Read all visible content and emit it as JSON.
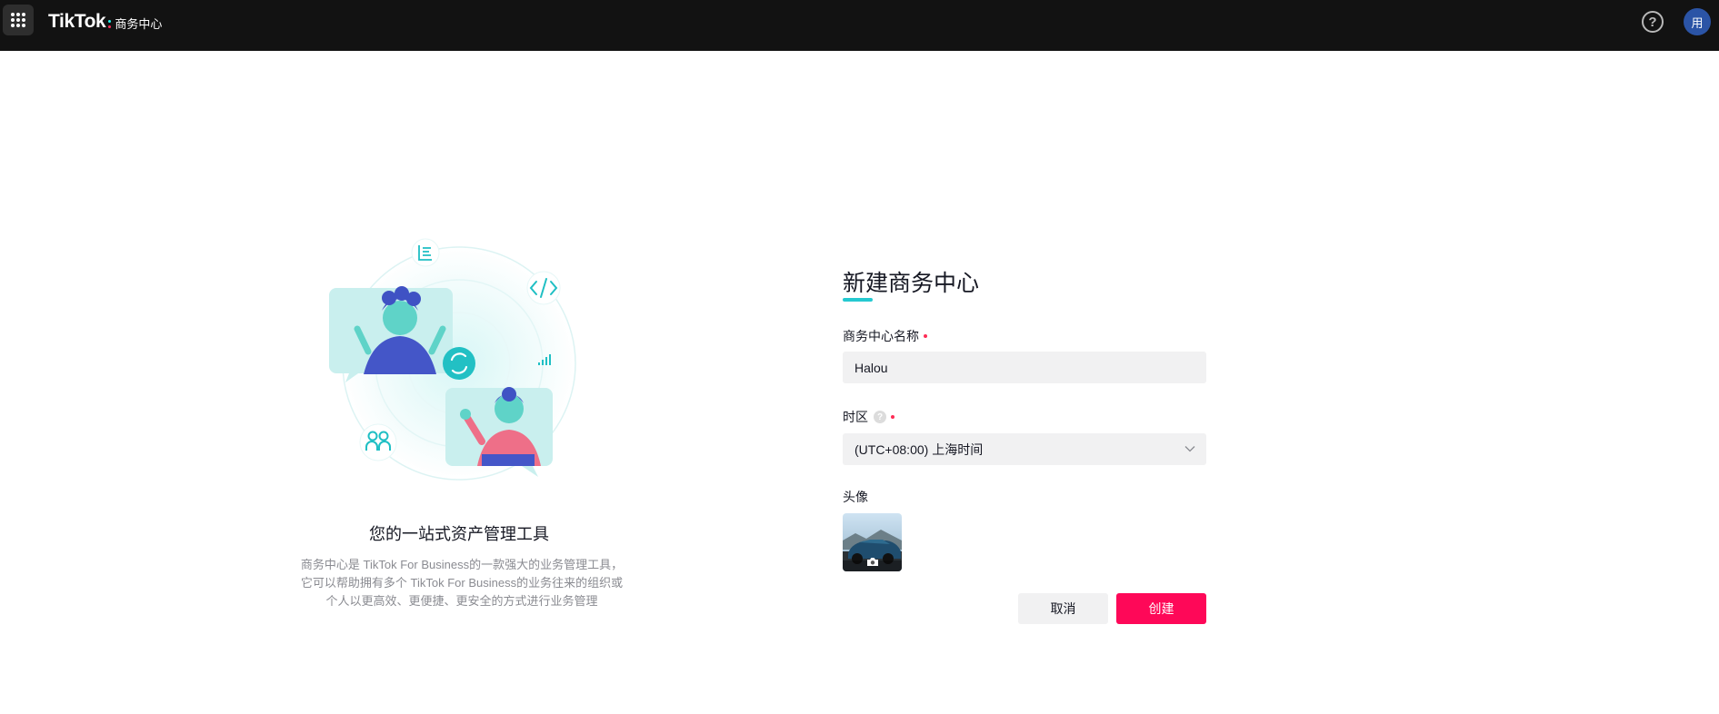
{
  "header": {
    "brand_name": "TikTok",
    "brand_sub": "商务中心",
    "help_glyph": "?",
    "avatar_initial": "用"
  },
  "icons": [
    "apps-grid-icon",
    "help-icon",
    "document-icon",
    "code-icon",
    "bar-chart-icon",
    "sync-icon",
    "users-icon",
    "camera-icon",
    "chevron-down-icon"
  ],
  "intro": {
    "title": "您的一站式资产管理工具",
    "description": "商务中心是 TikTok For Business的一款强大的业务管理工具，它可以帮助拥有多个 TikTok For Business的业务往来的组织或个人以更高效、更便捷、更安全的方式进行业务管理"
  },
  "form": {
    "title": "新建商务中心",
    "name_label": "商务中心名称",
    "name_value": "Halou",
    "timezone_label": "时区",
    "timezone_help": "?",
    "timezone_value": "(UTC+08:00) 上海时间",
    "avatar_label": "头像",
    "cancel_label": "取消",
    "create_label": "创建"
  },
  "colors": {
    "topbar": "#121212",
    "accent_teal": "#25c9d0",
    "primary": "#fe0858",
    "input_bg": "#f1f1f2",
    "avatar_bg": "#2b54a6"
  }
}
